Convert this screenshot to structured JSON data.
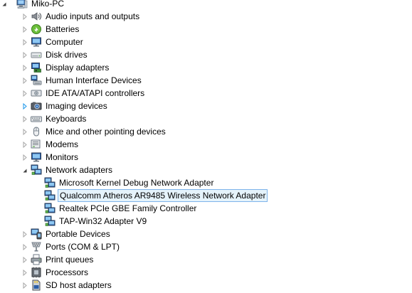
{
  "tree": {
    "root": {
      "label": "Miko-PC",
      "icon": "computer-icon",
      "expanded": true
    },
    "categories": [
      {
        "label": "Audio inputs and outputs",
        "icon": "speaker-icon",
        "expanded": false
      },
      {
        "label": "Batteries",
        "icon": "battery-icon",
        "expanded": false
      },
      {
        "label": "Computer",
        "icon": "monitor-icon",
        "expanded": false
      },
      {
        "label": "Disk drives",
        "icon": "disk-drive-icon",
        "expanded": false
      },
      {
        "label": "Display adapters",
        "icon": "display-adapter-icon",
        "expanded": false
      },
      {
        "label": "Human Interface Devices",
        "icon": "hid-icon",
        "expanded": false
      },
      {
        "label": "IDE ATA/ATAPI controllers",
        "icon": "ide-controller-icon",
        "expanded": false
      },
      {
        "label": "Imaging devices",
        "icon": "camera-icon",
        "expanded": false,
        "hover": true
      },
      {
        "label": "Keyboards",
        "icon": "keyboard-icon",
        "expanded": false
      },
      {
        "label": "Mice and other pointing devices",
        "icon": "mouse-icon",
        "expanded": false
      },
      {
        "label": "Modems",
        "icon": "modem-icon",
        "expanded": false
      },
      {
        "label": "Monitors",
        "icon": "monitor-icon",
        "expanded": false
      },
      {
        "label": "Network adapters",
        "icon": "network-adapter-icon",
        "expanded": true,
        "children": [
          {
            "label": "Microsoft Kernel Debug Network Adapter",
            "icon": "network-adapter-icon",
            "selected": false
          },
          {
            "label": "Qualcomm Atheros AR9485 Wireless Network Adapter",
            "icon": "network-adapter-icon",
            "selected": true
          },
          {
            "label": "Realtek PCIe GBE Family Controller",
            "icon": "network-adapter-icon",
            "selected": false
          },
          {
            "label": "TAP-Win32 Adapter V9",
            "icon": "network-adapter-icon",
            "selected": false
          }
        ]
      },
      {
        "label": "Portable Devices",
        "icon": "portable-device-icon",
        "expanded": false
      },
      {
        "label": "Ports (COM & LPT)",
        "icon": "port-icon",
        "expanded": false
      },
      {
        "label": "Print queues",
        "icon": "printer-icon",
        "expanded": false
      },
      {
        "label": "Processors",
        "icon": "processor-icon",
        "expanded": false
      },
      {
        "label": "SD host adapters",
        "icon": "sd-card-icon",
        "expanded": false
      }
    ]
  },
  "colors": {
    "selection_background": "#e5f3fb",
    "selection_border": "#7eb4ea",
    "arrow": "#a6a6a6",
    "arrow_hover": "#1c97ea",
    "expanded_arrow": "#404040"
  }
}
